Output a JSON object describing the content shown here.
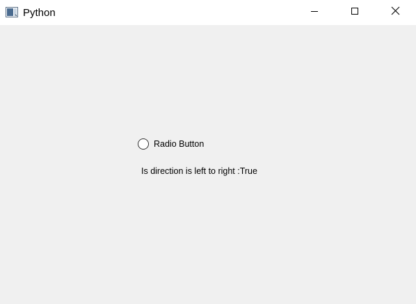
{
  "window": {
    "title": "Python"
  },
  "titlebar": {
    "icon": "python-window-icon",
    "buttons": {
      "minimize": "minimize-icon",
      "maximize": "maximize-icon",
      "close": "close-icon"
    }
  },
  "content": {
    "radio_button": {
      "label": "Radio Button",
      "checked": false
    },
    "direction_label": "Is direction is left to right :True"
  },
  "colors": {
    "titlebar_bg": "#ffffff",
    "client_bg": "#f0f0f0"
  }
}
